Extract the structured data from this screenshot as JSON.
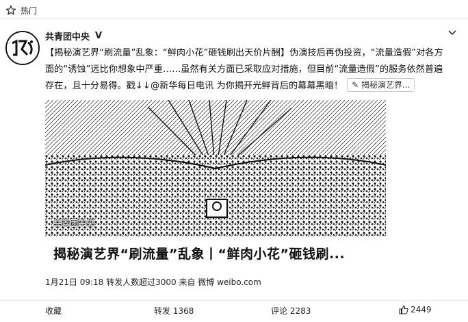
{
  "header": {
    "section_label": "热门"
  },
  "author": {
    "name": "共青团中央",
    "badge": "V"
  },
  "post": {
    "text": "【揭秘演艺界“刷流量”乱象：“鲜肉小花”砸钱刷出天价片酬】伪演技后再伪投资，“流量造假”对各方面的“诱蚀”远比你想象中严重……虽然有关方面已采取应对措施，但目前“流量造假”的服务依然普遍存在，且十分易得。戳↓↓@新华每日电讯 为你揭开光鲜背后的幕幕黑暗！",
    "tag_label": "揭秘演艺界..."
  },
  "media": {
    "watermark": "共青团中央"
  },
  "card": {
    "title": "揭秘演艺界“刷流量”乱象丨“鲜肉小花”砸钱刷..."
  },
  "meta": {
    "text": "1月21日 09:18 转发人数超过3000 来自 微博 weibo.com"
  },
  "actions": {
    "favorite": "收藏",
    "repost": "转发 1368",
    "comment": "评论 2283",
    "like": "2449"
  }
}
